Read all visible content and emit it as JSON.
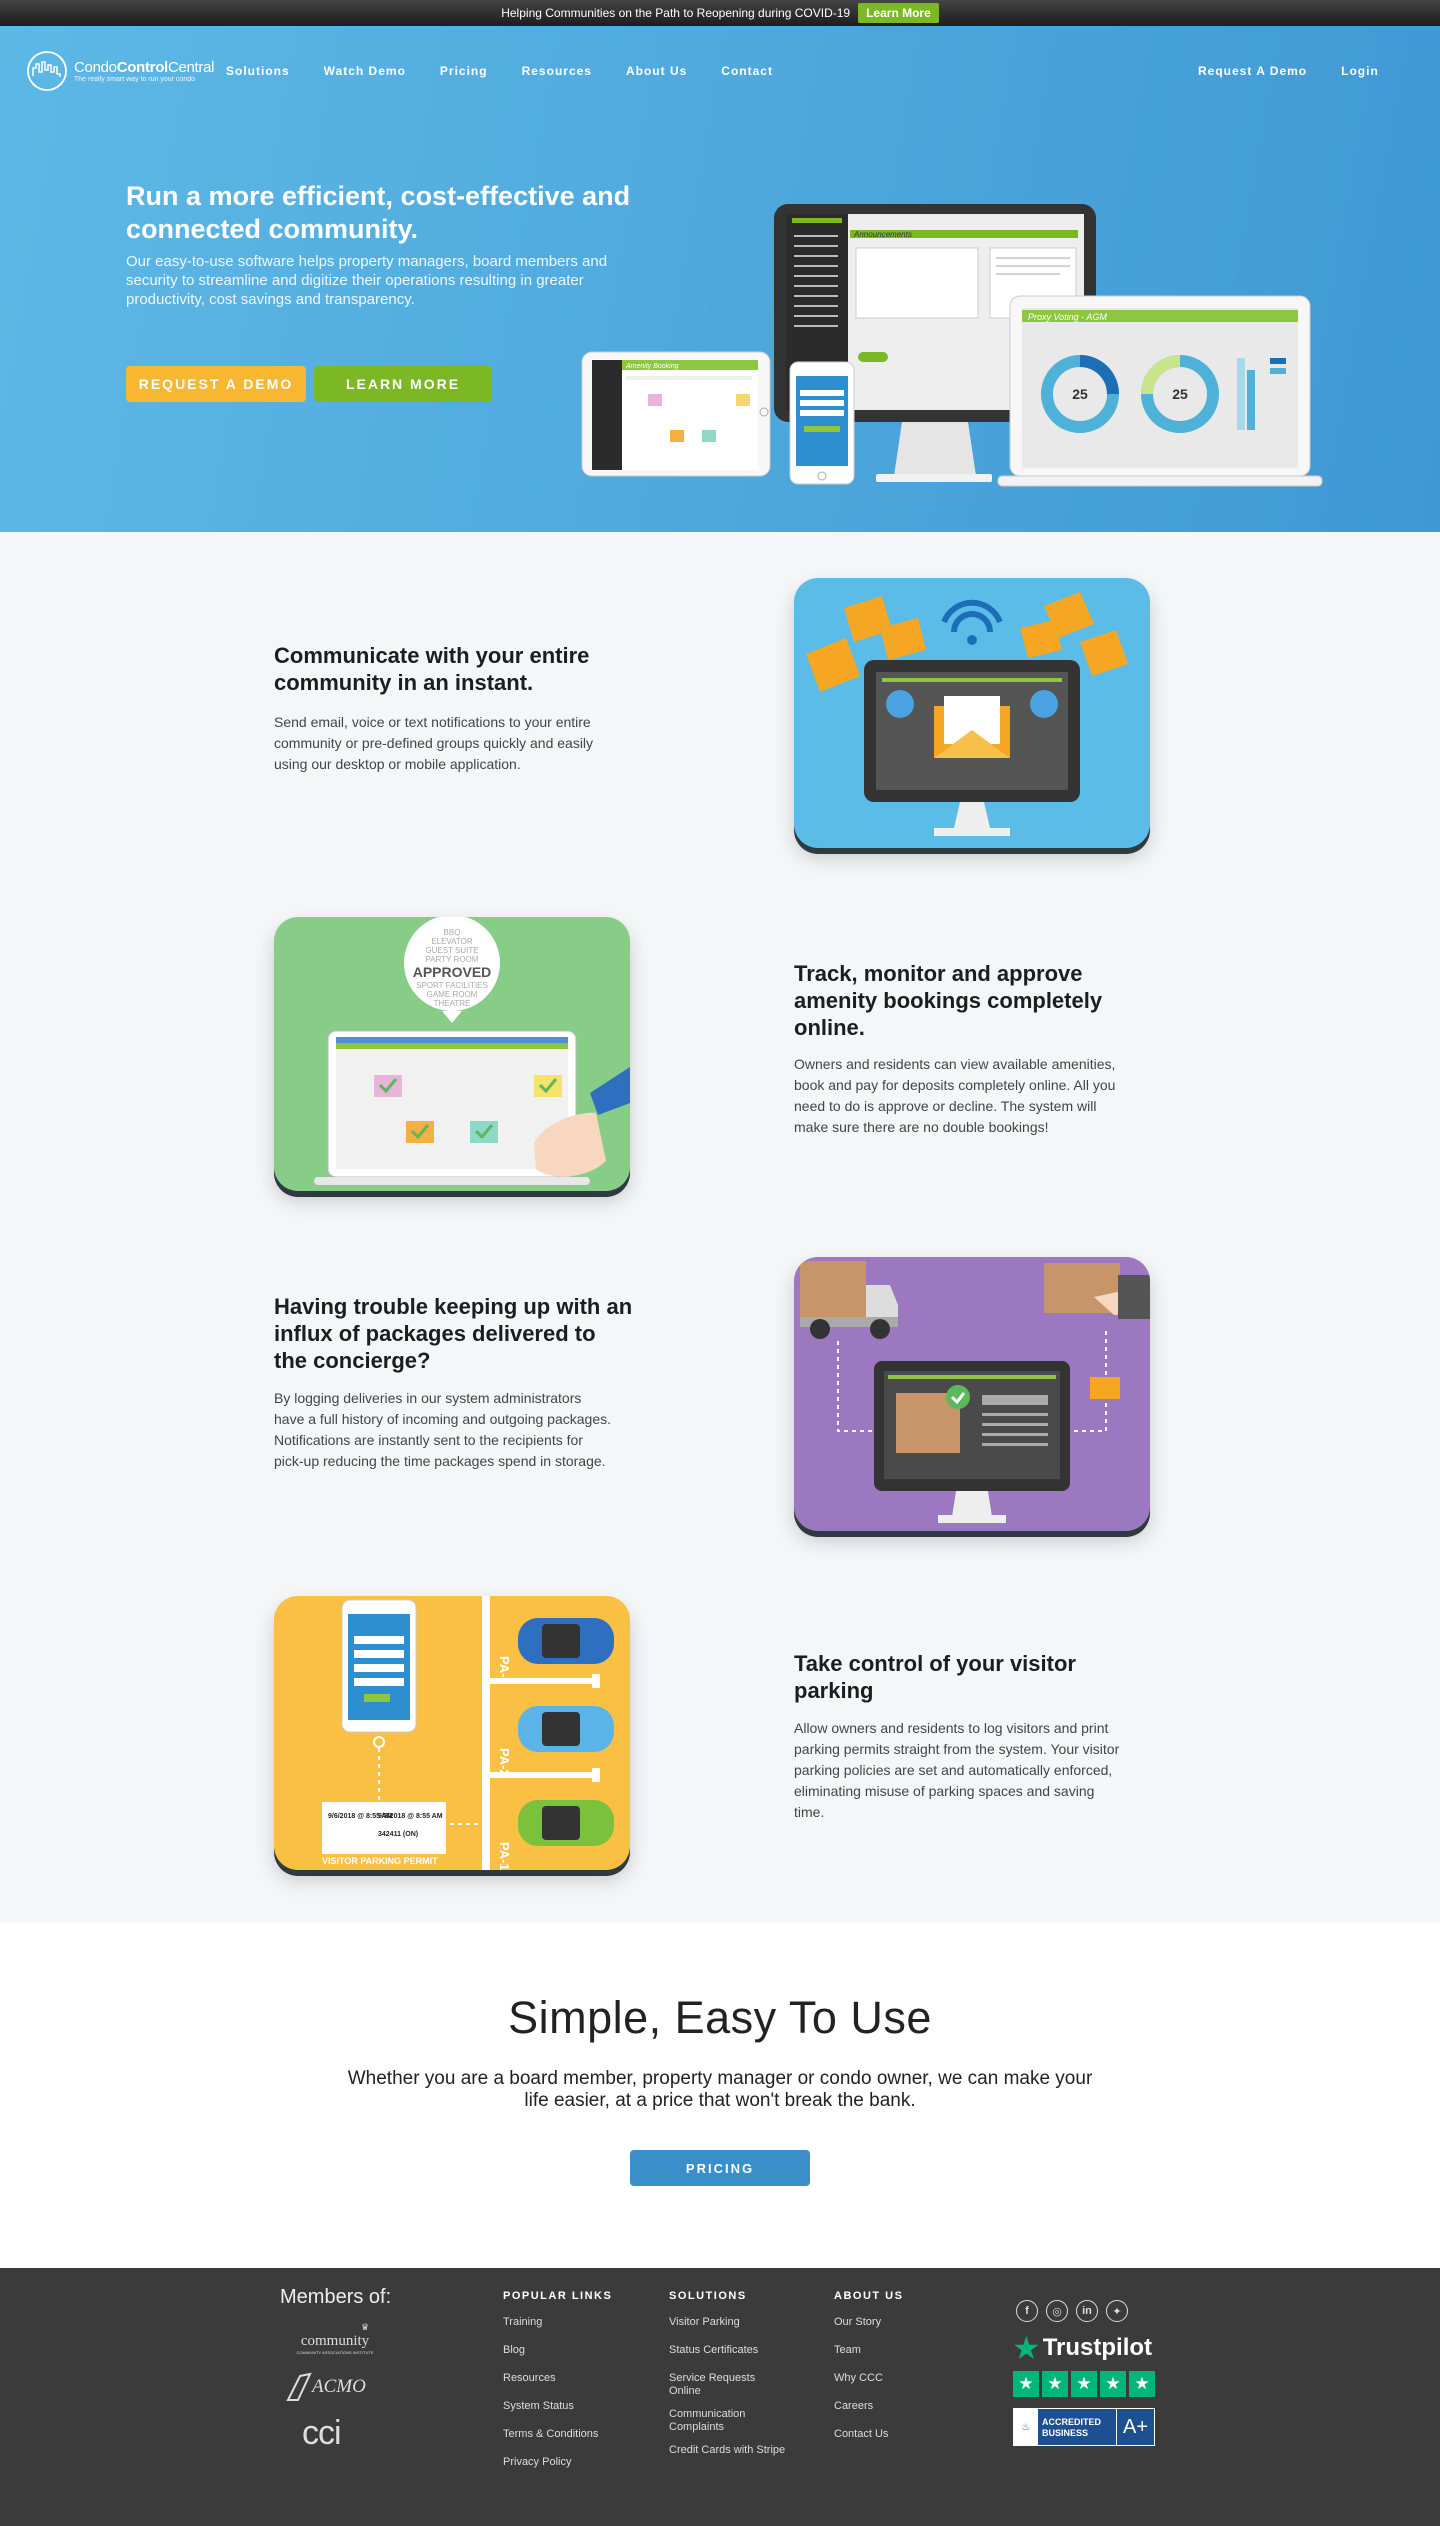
{
  "banner": {
    "text": "Helping Communities on the Path to Reopening during COVID-19",
    "button": "Learn More"
  },
  "brand": {
    "name_a": "Condo",
    "name_b": "Control",
    "name_c": "Central",
    "tagline": "The really smart way to run your condo"
  },
  "nav": {
    "items": [
      "Solutions",
      "Watch Demo",
      "Pricing",
      "Resources",
      "About Us",
      "Contact"
    ],
    "request_demo": "Request A Demo",
    "login": "Login"
  },
  "hero": {
    "title": "Run a more efficient, cost-effective and connected community.",
    "subtitle": "Our easy-to-use software helps property managers, board members and security to streamline and digitize their operations resulting in greater productivity, cost savings and transparency.",
    "btn_demo": "REQUEST A DEMO",
    "btn_learn": "LEARN MORE",
    "screen_announcements": "Announcements",
    "screen_proxy": "Proxy Voting - AGM",
    "screen_amenity": "Amenity Booking",
    "donut_1": "25",
    "donut_2": "25"
  },
  "features": [
    {
      "title": "Communicate with your entire community in an instant.",
      "text": "Send email, voice or text notifications to your entire community or pre-defined groups quickly and easily using our desktop or mobile application."
    },
    {
      "title": "Track, monitor and approve amenity bookings completely online.",
      "text": "Owners and residents can view available amenities, book and pay for deposits completely online. All you need to do is approve or decline. The system will make sure there are no double bookings!"
    },
    {
      "title": "Having trouble keeping up with an influx of packages delivered to the concierge?",
      "text": "By logging deliveries in our system administrators have a full history of incoming and outgoing packages. Notifications are instantly sent to the recipients for pick-up reducing the time packages spend in storage."
    },
    {
      "title": "Take control of your visitor parking",
      "text": "Allow owners and residents to log visitors and print parking permits straight from the system. Your visitor parking policies are set and automatically enforced, eliminating misuse of parking spaces and saving time."
    }
  ],
  "amenity_art": {
    "list": [
      "BBQ",
      "ELEVATOR",
      "GUEST SUITE",
      "PARTY ROOM",
      "APPROVED",
      "SPORT FACILITIES",
      "GAME ROOM",
      "THEATRE"
    ]
  },
  "parking_art": {
    "spots": [
      "PA-3",
      "PA-2",
      "PA-1"
    ],
    "permit_label": "VISITOR PARKING PERMIT",
    "permit_date_a": "9/6/2018 @ 8:55 AM",
    "permit_date_b": "9/8/2018 @ 8:55 AM",
    "permit_plate": "342411 (ON)"
  },
  "simple": {
    "title": "Simple, Easy To Use",
    "text": "Whether you are a board member, property manager or condo owner, we can make your life easier, at a price that won't break the bank.",
    "button": "PRICING"
  },
  "footer": {
    "members_title": "Members of:",
    "member_logos": [
      "community associations institute",
      "ACMO",
      "cci"
    ],
    "popular": {
      "title": "POPULAR LINKS",
      "links": [
        "Training",
        "Blog",
        "Resources",
        "System Status",
        "Terms & Conditions",
        "Privacy Policy"
      ]
    },
    "solutions": {
      "title": "SOLUTIONS",
      "links": [
        "Visitor Parking",
        "Status Certificates",
        "Service Requests Online",
        "Communication Complaints",
        "Credit Cards with Stripe"
      ]
    },
    "about": {
      "title": "ABOUT US",
      "links": [
        "Our Story",
        "Team",
        "Why CCC",
        "Careers",
        "Contact Us"
      ]
    },
    "social": [
      "facebook-icon",
      "instagram-icon",
      "linkedin-icon",
      "twitter-icon"
    ],
    "trustpilot": "Trustpilot",
    "bbb": {
      "line1": "ACCREDITED",
      "line2": "BUSINESS",
      "grade": "A+"
    }
  },
  "colors": {
    "hero_blue": "#4da7dc",
    "accent_yellow": "#f7b731",
    "accent_green": "#7cb824",
    "pricing_blue": "#3a8fcb",
    "footer_bg": "#3b3b3b"
  }
}
